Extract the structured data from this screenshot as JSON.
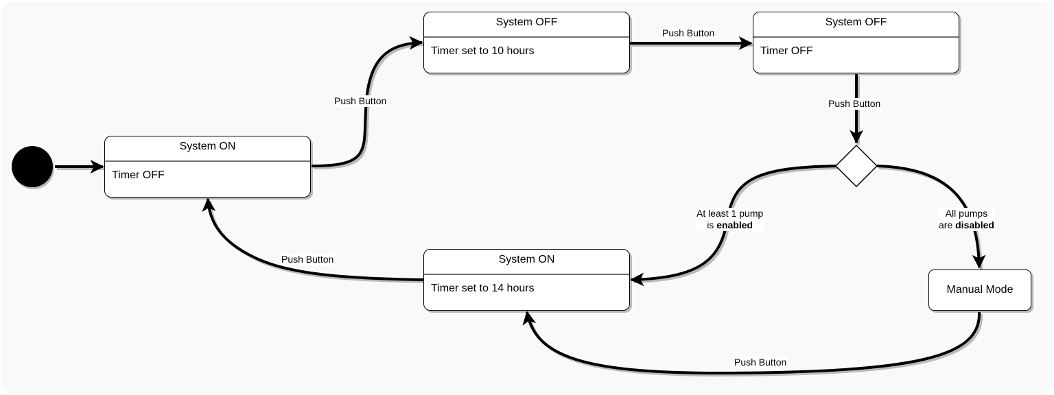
{
  "diagram": {
    "type": "state-machine",
    "initial_state": {
      "label": ""
    },
    "states": [
      {
        "id": "s1",
        "title": "System ON",
        "body": "Timer OFF"
      },
      {
        "id": "s2",
        "title": "System OFF",
        "body": "Timer set to 10 hours"
      },
      {
        "id": "s3",
        "title": "System OFF",
        "body": "Timer OFF"
      },
      {
        "id": "s4",
        "title": "System ON",
        "body": "Timer set to 14 hours"
      },
      {
        "id": "s5",
        "title": "Manual Mode"
      }
    ],
    "decision": {
      "id": "d1",
      "shape": "diamond"
    },
    "transitions": [
      {
        "from": "initial",
        "to": "s1",
        "label": ""
      },
      {
        "from": "s1",
        "to": "s2",
        "label": "Push Button"
      },
      {
        "from": "s2",
        "to": "s3",
        "label": "Push Button"
      },
      {
        "from": "s3",
        "to": "d1",
        "label": "Push Button"
      },
      {
        "from": "d1",
        "to": "s4",
        "label_line1": "At least 1 pump",
        "label_prefix": "is ",
        "label_bold": "enabled"
      },
      {
        "from": "d1",
        "to": "s5",
        "label_line1": "All pumps",
        "label_prefix": "are ",
        "label_bold": "disabled"
      },
      {
        "from": "s4",
        "to": "s1",
        "label": "Push Button"
      },
      {
        "from": "s5",
        "to": "s4",
        "label": "Push Button"
      }
    ]
  },
  "colors": {
    "canvas_background": "#f9f9f9",
    "node_fill": "#ffffff",
    "stroke": "#000000",
    "divider": "#707070"
  }
}
